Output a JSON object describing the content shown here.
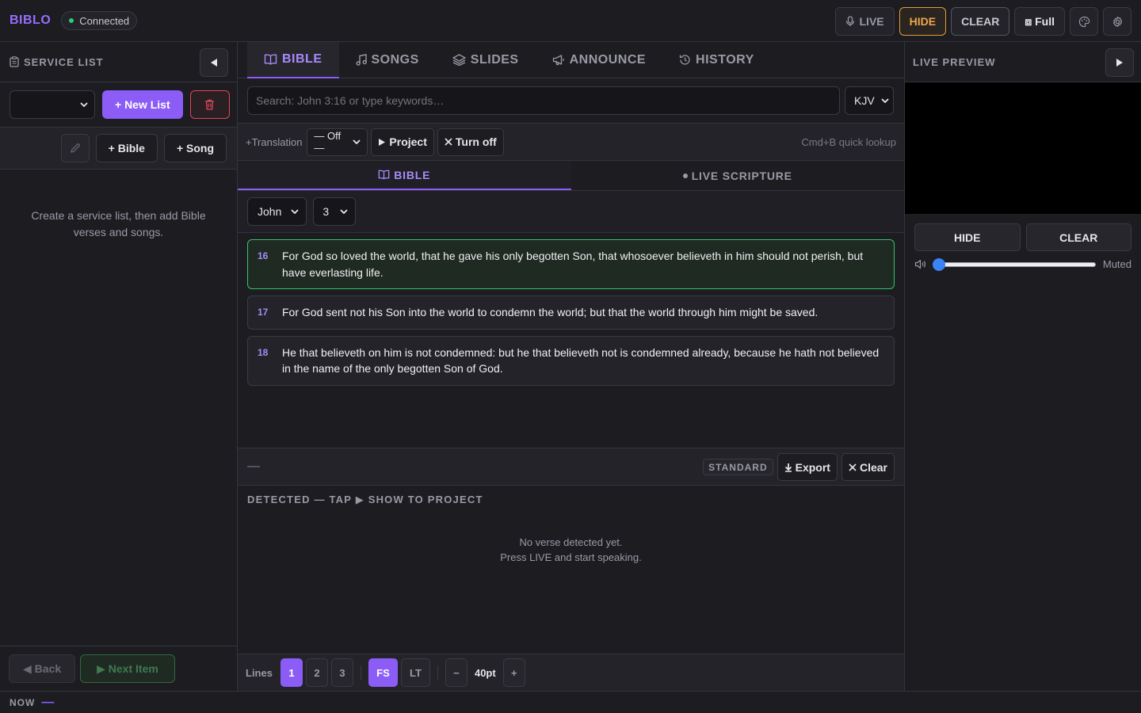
{
  "app": {
    "title": "BIBLO",
    "status": "Connected"
  },
  "topbar": {
    "live": "LIVE",
    "hide": "HIDE",
    "clear": "CLEAR",
    "full": "⧈ Full"
  },
  "service_list": {
    "title": "SERVICE LIST",
    "new_list": "+ New List",
    "add_bible": "+ Bible",
    "add_song": "+ Song",
    "empty": "Create a service list, then add Bible verses and songs.",
    "back": "◀ Back",
    "next": "▶ Next Item"
  },
  "tabs": [
    {
      "label": "BIBLE"
    },
    {
      "label": "SONGS"
    },
    {
      "label": "SLIDES"
    },
    {
      "label": "ANNOUNCE"
    },
    {
      "label": "HISTORY"
    }
  ],
  "search": {
    "placeholder": "Search: John 3:16 or type keywords…",
    "translation": "KJV"
  },
  "translation_row": {
    "label": "+Translation",
    "off": "— Off —",
    "project": "Project",
    "turn_off": "Turn off",
    "hint": "Cmd+B quick lookup"
  },
  "subtabs": [
    {
      "label": "BIBLE"
    },
    {
      "label": "LIVE SCRIPTURE"
    }
  ],
  "selector": {
    "book": "John",
    "chapter": "3"
  },
  "verses": [
    {
      "num": "16",
      "text": "For God so loved the world, that he gave his only begotten Son, that whosoever believeth in him should not perish, but have everlasting life."
    },
    {
      "num": "17",
      "text": "For God sent not his Son into the world to condemn the world; but that the world through him might be saved."
    },
    {
      "num": "18",
      "text": "He that believeth on him is not condemned: but he that believeth not is condemned already, because he hath not believed in the name of the only begotten Son of God."
    }
  ],
  "output_bar": {
    "dash": "—",
    "mode": "STANDARD",
    "export": "Export",
    "clear": "Clear"
  },
  "detected": {
    "title": "DETECTED — TAP ▶ SHOW TO PROJECT",
    "line1": "No verse detected yet.",
    "line2": "Press LIVE and start speaking."
  },
  "bottombar": {
    "lines_label": "Lines",
    "l1": "1",
    "l2": "2",
    "l3": "3",
    "fs": "FS",
    "lt": "LT",
    "minus": "−",
    "size": "40pt",
    "plus": "+"
  },
  "live_preview": {
    "title": "LIVE PREVIEW",
    "hide": "HIDE",
    "clear": "CLEAR",
    "muted": "Muted",
    "volume": 0
  },
  "statusbar": {
    "now": "NOW",
    "value": "—"
  },
  "colors": {
    "accent": "#8b5cf6",
    "live_green": "#35c46a",
    "hide_orange": "#f0a54a",
    "danger": "#d94a5a"
  }
}
